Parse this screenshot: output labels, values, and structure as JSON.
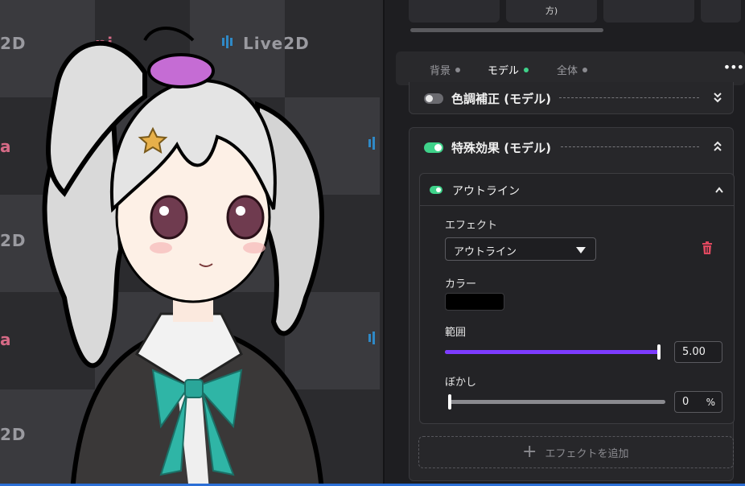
{
  "presets": [
    {
      "label": ""
    },
    {
      "label": "方)"
    },
    {
      "label": ""
    },
    {
      "label": ""
    }
  ],
  "stage": {
    "logos": [
      "2D",
      "Live2D",
      "2D",
      "2D",
      "2D"
    ],
    "pink_logos": [
      "ni",
      "a",
      "a"
    ]
  },
  "tabs": [
    {
      "label": "背景",
      "active": false
    },
    {
      "label": "モデル",
      "active": true
    },
    {
      "label": "全体",
      "active": false
    }
  ],
  "more_label": "•••",
  "color_correction": {
    "title": "色調補正 (モデル)",
    "enabled": false
  },
  "special_effects": {
    "title": "特殊効果 (モデル)",
    "enabled": true,
    "effect": {
      "title": "アウトライン",
      "enabled": true,
      "effect_label": "エフェクト",
      "effect_value": "アウトライン",
      "color_label": "カラー",
      "color_value": "#000000",
      "range_label": "範囲",
      "range_value": "5.00",
      "range_fraction": 1.0,
      "blur_label": "ぼかし",
      "blur_value": "0",
      "blur_unit": "%",
      "blur_fraction": 0.0
    }
  },
  "add_effect_label": "エフェクトを追加",
  "colors": {
    "accent_purple": "#7d3bff",
    "toggle_green": "#3fd28a",
    "delete_red": "#e0485f"
  }
}
